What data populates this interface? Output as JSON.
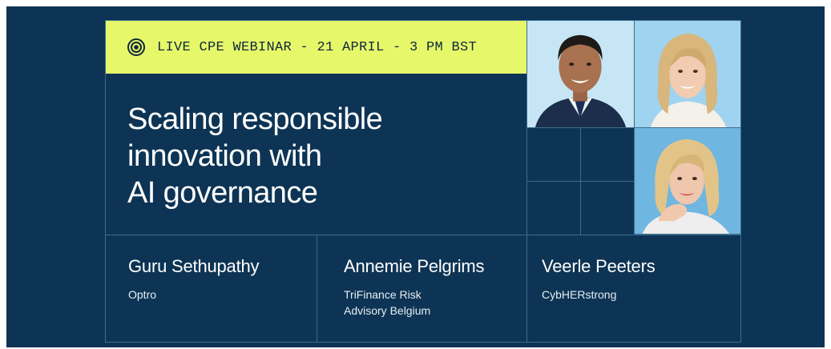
{
  "banner": {
    "live_label": "LIVE CPE WEBINAR - 21 APRIL - 3 PM BST",
    "title_lines": [
      "Scaling responsible",
      "innovation with",
      "AI governance"
    ]
  },
  "speakers": [
    {
      "name": "Guru Sethupathy",
      "org_lines": [
        "Optro"
      ]
    },
    {
      "name": "Annemie Pelgrims",
      "org_lines": [
        "TriFinance Risk",
        "Advisory Belgium"
      ]
    },
    {
      "name": "Veerle Peeters",
      "org_lines": [
        "CybHERstrong"
      ]
    }
  ],
  "colors": {
    "background": "#0d3454",
    "accent": "#e6f86a",
    "grid_line": "#3c6c8a",
    "photo_bg": "#bfe3f7"
  },
  "icons": {
    "live": "broadcast-target-icon"
  }
}
